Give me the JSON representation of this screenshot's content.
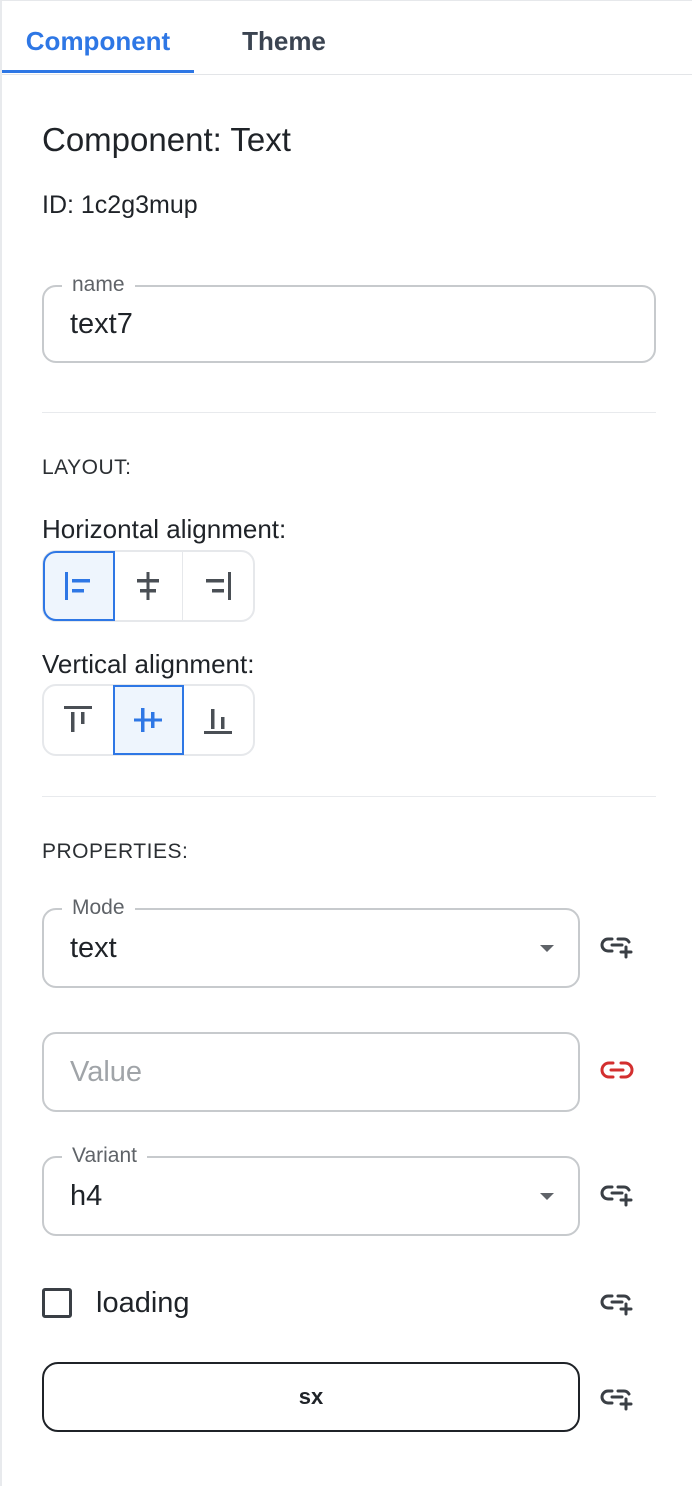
{
  "tabs": [
    {
      "label": "Component",
      "active": true
    },
    {
      "label": "Theme",
      "active": false
    }
  ],
  "component": {
    "title": "Component: Text",
    "id_line": "ID: 1c2g3mup"
  },
  "name_field": {
    "legend": "name",
    "value": "text7"
  },
  "layout": {
    "section_label": "LAYOUT:",
    "horizontal_label": "Horizontal alignment:",
    "horizontal_options": [
      "align-left-icon",
      "align-center-horizontal-icon",
      "align-right-icon"
    ],
    "horizontal_selected": "left",
    "vertical_label": "Vertical alignment:",
    "vertical_options": [
      "align-top-icon",
      "align-center-vertical-icon",
      "align-bottom-icon"
    ],
    "vertical_selected": "center"
  },
  "properties": {
    "section_label": "PROPERTIES:",
    "mode": {
      "legend": "Mode",
      "value": "text"
    },
    "value_field": {
      "placeholder": "Value"
    },
    "variant": {
      "legend": "Variant",
      "value": "h4"
    },
    "loading": {
      "label": "loading",
      "checked": false
    },
    "sx_button": {
      "label": "sx"
    }
  },
  "colors": {
    "accent": "#2e77e5",
    "link_icon_default": "#3a3f45",
    "link_icon_active": "#d32f2f"
  }
}
